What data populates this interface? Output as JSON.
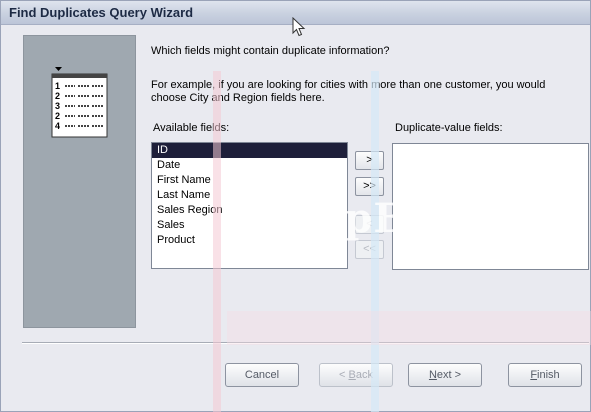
{
  "window": {
    "title": "Find Duplicates Query Wizard"
  },
  "illustration": {
    "rows": [
      {
        "number": "1"
      },
      {
        "number": "2"
      },
      {
        "number": "3"
      },
      {
        "number": "2"
      },
      {
        "number": "4"
      }
    ]
  },
  "instructions": {
    "question": "Which fields might contain duplicate information?",
    "example": "For example, if you are looking for cities with more than one customer, you would choose City and Region fields here."
  },
  "available_fields": {
    "label": "Available fields:",
    "items": [
      "ID",
      "Date",
      "First Name",
      "Last Name",
      "Sales Region",
      "Sales",
      "Product"
    ],
    "selected": "ID"
  },
  "duplicate_fields": {
    "label": "Duplicate-value fields:",
    "items": []
  },
  "move_buttons": {
    "add": ">",
    "add_all": ">>",
    "remove": "<",
    "remove_all": "<<"
  },
  "footer": {
    "cancel": "Cancel",
    "back_prefix": "< ",
    "back_key": "B",
    "back_rest": "ack",
    "next_key": "N",
    "next_rest": "ext >",
    "finish_key": "F",
    "finish_rest": "inish"
  },
  "watermark": {
    "text": "DropBooks"
  },
  "colors": {
    "selection": "#1e1f3a",
    "side_panel": "#9fa8b0",
    "titlebar": "#c9d1e0"
  }
}
